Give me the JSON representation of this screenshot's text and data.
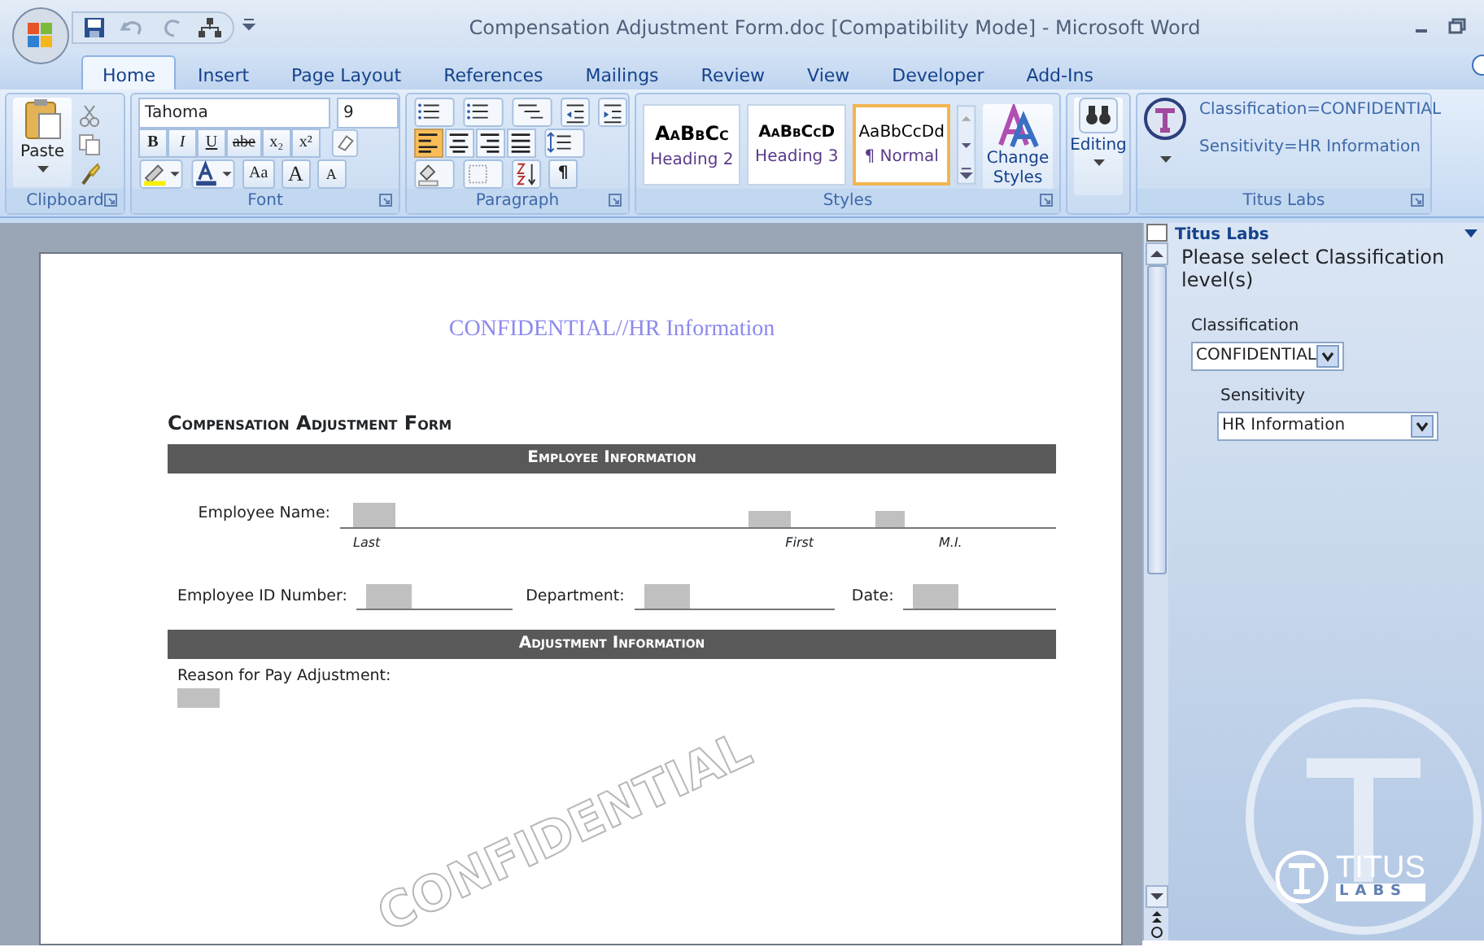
{
  "title_bar": {
    "title": "Compensation Adjustment Form.doc [Compatibility Mode] - Microsoft Word"
  },
  "tabs": [
    {
      "label": "Home",
      "selected": true
    },
    {
      "label": "Insert",
      "selected": false
    },
    {
      "label": "Page Layout",
      "selected": false
    },
    {
      "label": "References",
      "selected": false
    },
    {
      "label": "Mailings",
      "selected": false
    },
    {
      "label": "Review",
      "selected": false
    },
    {
      "label": "View",
      "selected": false
    },
    {
      "label": "Developer",
      "selected": false
    },
    {
      "label": "Add-Ins",
      "selected": false
    }
  ],
  "ribbon": {
    "clipboard": {
      "paste_label": "Paste",
      "group_label": "Clipboard"
    },
    "font": {
      "font_name": "Tahoma",
      "font_size": "9",
      "format_buttons": [
        "B",
        "I",
        "U",
        "abe",
        "x₂",
        "x²"
      ],
      "case_button": "Aa",
      "grow_button": "A",
      "shrink_button": "A",
      "group_label": "Font"
    },
    "paragraph": {
      "align_buttons": [
        {
          "selected": true
        },
        {
          "selected": false
        },
        {
          "selected": false
        },
        {
          "selected": false
        }
      ],
      "pilcrow": "¶",
      "group_label": "Paragraph"
    },
    "styles": {
      "gallery": [
        {
          "preview": "AaBbCc",
          "name": "Heading 2",
          "selected": false
        },
        {
          "preview": "AaBbCcD",
          "name": "Heading 3",
          "selected": false
        },
        {
          "preview": "AaBbCcDd",
          "name": "¶ Normal",
          "selected": true
        }
      ],
      "change_styles": "Change Styles",
      "group_label": "Styles"
    },
    "editing": {
      "label": "Editing"
    },
    "titus": {
      "classification": "Classification=CONFIDENTIAL",
      "sensitivity": "Sensitivity=HR Information",
      "group_label": "Titus Labs"
    }
  },
  "document": {
    "header": "CONFIDENTIAL//HR Information",
    "form_title": "Compensation Adjustment Form",
    "watermark": "CONFIDENTIAL",
    "sections": [
      {
        "heading": "Employee Information",
        "name_label": "Employee Name:",
        "name_parts": [
          "Last",
          "First",
          "M.I."
        ],
        "id_label": "Employee ID Number:",
        "department_label": "Department:",
        "date_label": "Date:"
      },
      {
        "heading": "Adjustment Information",
        "reason_label": "Reason for Pay Adjustment:"
      }
    ]
  },
  "task_pane": {
    "title": "Titus Labs",
    "prompt": "Please select Classification level(s)",
    "classification_label": "Classification",
    "classification_value": "CONFIDENTIAL",
    "sensitivity_label": "Sensitivity",
    "sensitivity_value": "HR Information",
    "logo_name": "TITUS",
    "logo_sub": "LABS"
  }
}
